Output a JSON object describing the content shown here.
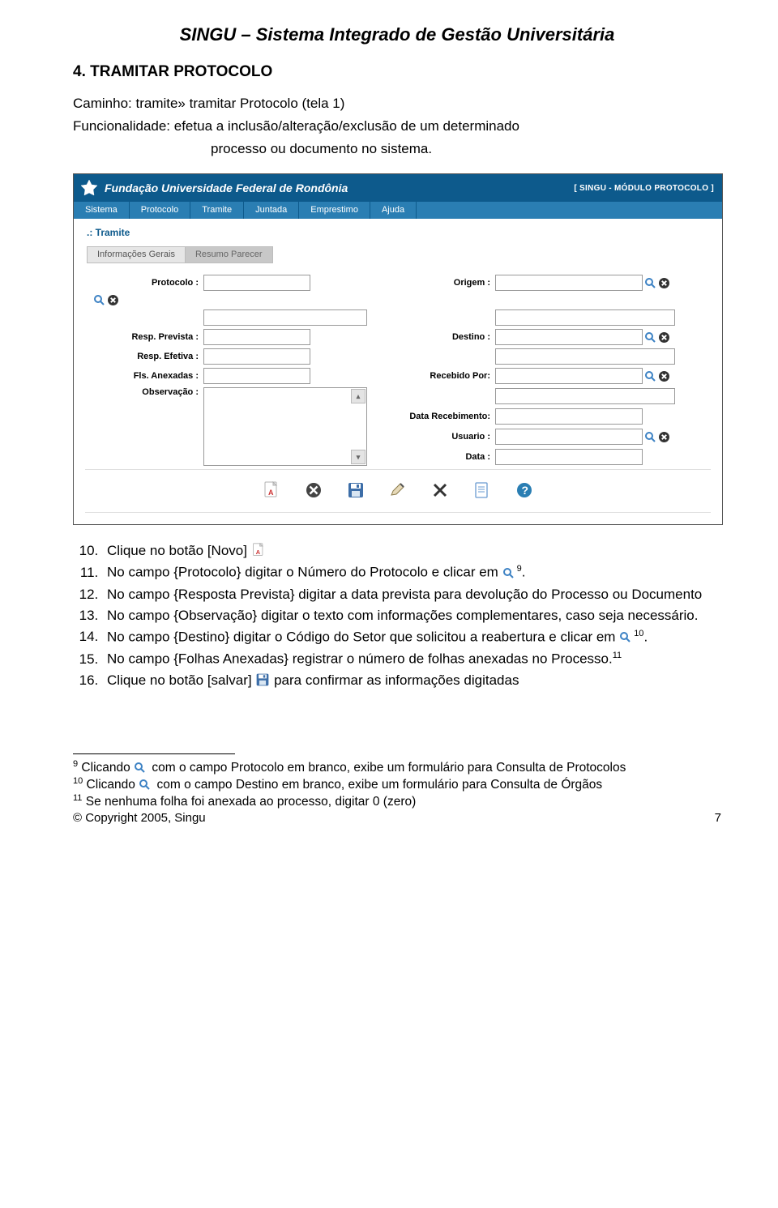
{
  "doc": {
    "title": "SINGU – Sistema Integrado de Gestão Universitária",
    "section_heading": "4. TRAMITAR PROTOCOLO",
    "caminho": "Caminho: tramite» tramitar Protocolo (tela 1)",
    "funcionalidade_label": "Funcionalidade: efetua a inclusão/alteração/exclusão de um determinado",
    "funcionalidade_cont": "processo ou documento no sistema."
  },
  "app": {
    "header_title": "Fundação Universidade Federal de Rondônia",
    "header_badge": "[ SINGU - MÓDULO PROTOCOLO ]",
    "menu": [
      "Sistema",
      "Protocolo",
      "Tramite",
      "Juntada",
      "Emprestimo",
      "Ajuda"
    ],
    "section_label": ".: Tramite",
    "tabs": [
      "Informações Gerais",
      "Resumo Parecer"
    ],
    "labels": {
      "protocolo": "Protocolo :",
      "resp_prevista": "Resp. Prevista :",
      "resp_efetiva": "Resp. Efetiva :",
      "fls_anexadas": "Fls. Anexadas :",
      "observacao": "Observação :",
      "origem": "Origem :",
      "destino": "Destino :",
      "recebido_por": "Recebido Por:",
      "data_recebimento": "Data Recebimento:",
      "usuario": "Usuario :",
      "data": "Data :"
    }
  },
  "list": {
    "start": 10,
    "i10a": "Clique no botão [Novo]",
    "i11a": "No campo {Protocolo} digitar o Número do Protocolo e clicar em ",
    "i11b": "9",
    "i11c": ".",
    "i12": "No campo {Resposta Prevista} digitar a data prevista para devolução do Processo ou Documento",
    "i13": "No campo {Observação} digitar o texto com informações complementares, caso seja necessário.",
    "i14a": "No campo {Destino} digitar o Código do Setor que solicitou a reabertura e clicar em ",
    "i14b": "10",
    "i14c": ".",
    "i15a": "No campo {Folhas Anexadas} registrar o número de folhas anexadas no Processo.",
    "i15b": "11",
    "i16a": "Clique no botão [salvar] ",
    "i16b": " para confirmar as informações digitadas"
  },
  "footnotes": {
    "f9n": "9",
    "f9a": " Clicando ",
    "f9b": " com o campo Protocolo em branco, exibe um formulário para Consulta de Protocolos",
    "f10n": "10",
    "f10a": " Clicando ",
    "f10b": " com o campo Destino em branco, exibe um formulário para Consulta de Órgãos",
    "f11n": "11",
    "f11": " Se nenhuma folha foi anexada ao processo, digitar 0 (zero)"
  },
  "footer": {
    "copyright": "© Copyright 2005, Singu",
    "page": "7"
  }
}
